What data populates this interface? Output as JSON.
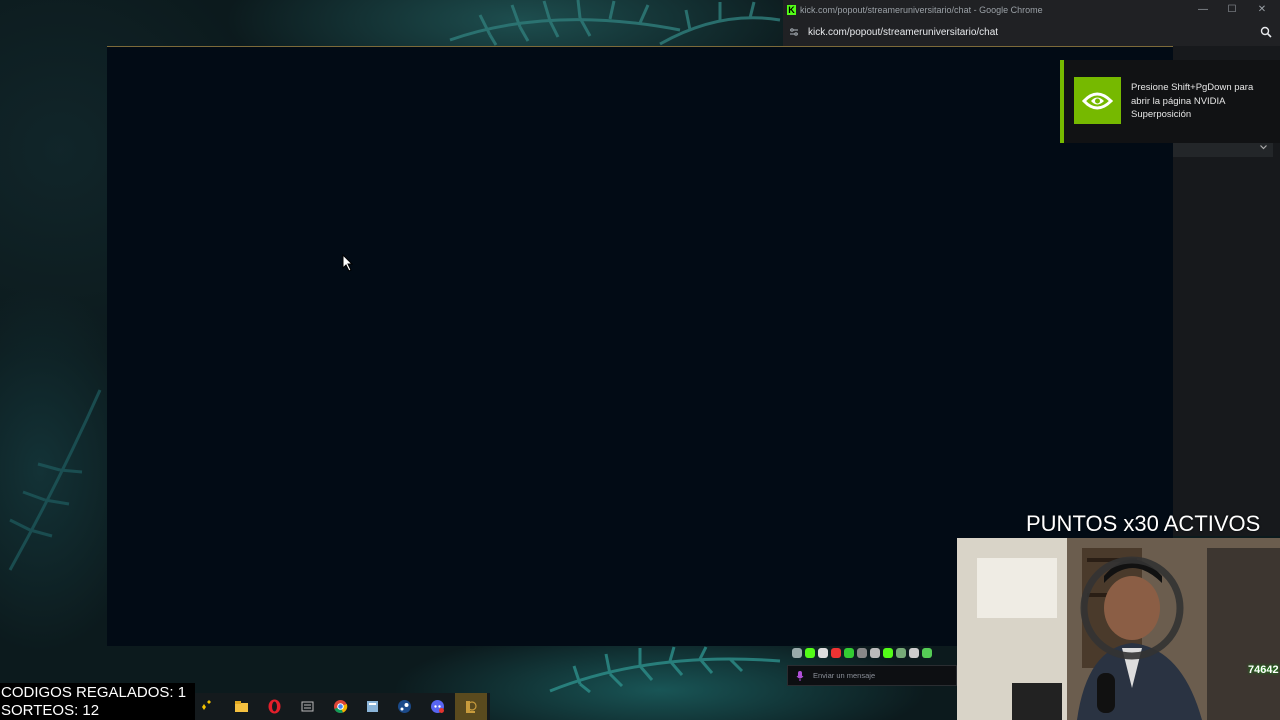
{
  "chrome": {
    "title": "kick.com/popout/streameruniversitario/chat - Google Chrome",
    "url": "kick.com/popout/streameruniversitario/chat",
    "favicon": "kick-logo-icon",
    "buttons": [
      "minimize",
      "maximize",
      "close"
    ],
    "minimize_glyph": "—",
    "maximize_glyph": "☐",
    "close_glyph": "✕",
    "favicon_letter": "K"
  },
  "nvidia_toast": {
    "message": "Presione Shift+PgDown para abrir la página NVIDIA Superposición",
    "accent": "#76b900"
  },
  "chat": {
    "input_placeholder": "Enviar un mensaje"
  },
  "overlay": {
    "puntos": "PUNTOS x30 ACTIVOS",
    "codigos": "CODIGOS REGALADOS: 1",
    "sorteos": "SORTEOS: 12",
    "webcam_counter": "74642"
  },
  "taskbar": {
    "icons": [
      "copilot-icon",
      "file-explorer-icon",
      "opera-icon",
      "league-launcher-icon",
      "chrome-icon",
      "calculator-icon",
      "steam-icon",
      "discord-icon",
      "league-of-legends-icon"
    ]
  },
  "colors": {
    "window_bg": "#020b15",
    "panel_bg": "#17191c",
    "kick_green": "#53fc18"
  }
}
